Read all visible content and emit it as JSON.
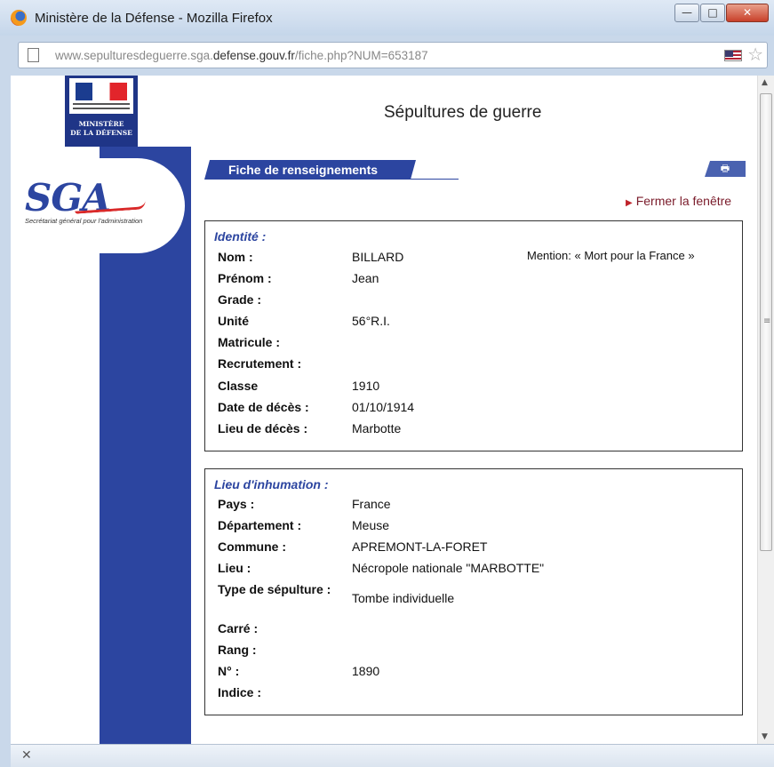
{
  "window": {
    "title": "Ministère de la Défense - Mozilla Firefox",
    "minimize": "—",
    "maximize": "□",
    "close": "✕"
  },
  "address_bar": {
    "url_prefix": "www.sepulturesdeguerre.sga.",
    "url_host": "defense.gouv.fr",
    "url_path": "/fiche.php?NUM=653187"
  },
  "header": {
    "ministere_label_1": "MINISTÈRE",
    "ministere_label_2": "DE LA DÉFENSE",
    "sga_logo": "SGA",
    "sga_subtitle": "Secrétariat général pour l'administration",
    "page_title": "Sépultures de guerre"
  },
  "toolbar": {
    "fiche_tab": "Fiche de renseignements",
    "print_icon": "🖶",
    "close_window": "Fermer la fenêtre"
  },
  "identite": {
    "title": "Identité :",
    "mention": "Mention: « Mort pour la France »",
    "rows": [
      {
        "label": "Nom :",
        "value": "BILLARD"
      },
      {
        "label": "Prénom :",
        "value": "Jean"
      },
      {
        "label": "Grade :",
        "value": ""
      },
      {
        "label": "Unité",
        "value": "56°R.I."
      },
      {
        "label": "Matricule :",
        "value": ""
      },
      {
        "label": "Recrutement :",
        "value": ""
      },
      {
        "label": "Classe",
        "value": "1910"
      },
      {
        "label": "Date de décès :",
        "value": "01/10/1914"
      },
      {
        "label": "Lieu de décès :",
        "value": "Marbotte"
      }
    ]
  },
  "inhumation": {
    "title": "Lieu d'inhumation :",
    "rows": [
      {
        "label": "Pays :",
        "value": "France"
      },
      {
        "label": "Département :",
        "value": "Meuse"
      },
      {
        "label": "Commune :",
        "value": "APREMONT-LA-FORET"
      },
      {
        "label": "Lieu :",
        "value": "Nécropole nationale \"MARBOTTE\""
      },
      {
        "label": "Type de sépulture :",
        "value": "Tombe individuelle"
      },
      {
        "label": "Carré :",
        "value": ""
      },
      {
        "label": "Rang :",
        "value": ""
      },
      {
        "label": "N° :",
        "value": "1890"
      },
      {
        "label": "Indice :",
        "value": ""
      }
    ]
  },
  "statusbar": {
    "close": "✕"
  }
}
